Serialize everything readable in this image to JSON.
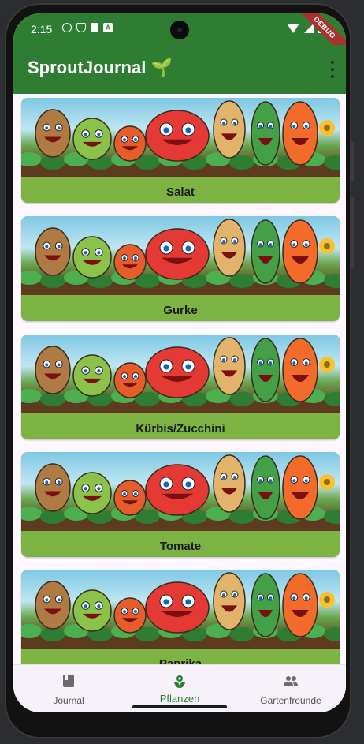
{
  "status_bar": {
    "time": "2:15",
    "debug_banner": "DEBUG"
  },
  "app_bar": {
    "title": "SproutJournal 🌱",
    "menu_icon": "more-vert-icon"
  },
  "plants": [
    {
      "name": "Salat"
    },
    {
      "name": "Gurke"
    },
    {
      "name": "Kürbis/Zucchini"
    },
    {
      "name": "Tomate"
    },
    {
      "name": "Paprika"
    }
  ],
  "bottom_nav": {
    "items": [
      {
        "label": "Journal",
        "icon": "book-icon",
        "active": false
      },
      {
        "label": "Pflanzen",
        "icon": "plant-icon",
        "active": true
      },
      {
        "label": "Gartenfreunde",
        "icon": "people-icon",
        "active": false
      }
    ]
  },
  "colors": {
    "primary": "#2e7d32",
    "card_label_bg": "#7cb342",
    "background": "#fef7ff"
  }
}
